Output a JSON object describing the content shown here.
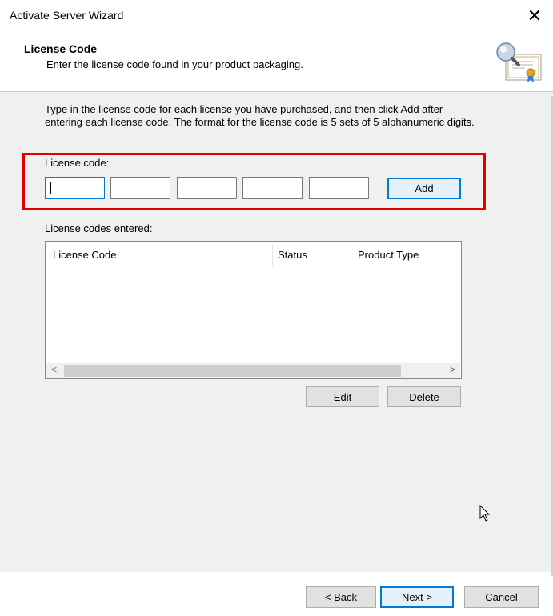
{
  "window": {
    "title": "Activate Server Wizard",
    "close_glyph": "✕"
  },
  "header": {
    "title": "License Code",
    "subtitle": "Enter the license code found in your product packaging.",
    "icon": "certificate-icon"
  },
  "body": {
    "instructions": "Type in the license code for each license you have purchased, and then click Add after entering each license code. The format for the license code is 5 sets of 5 alphanumeric digits.",
    "license_code_label": "License code:",
    "code_fields": [
      "",
      "",
      "",
      "",
      ""
    ],
    "add_label": "Add",
    "entered_label": "License codes entered:",
    "columns": [
      "License Code",
      "Status",
      "Product Type"
    ],
    "rows": [],
    "scroll_left": "<",
    "scroll_right": ">",
    "edit_label": "Edit",
    "delete_label": "Delete"
  },
  "footer": {
    "back_label": "< Back",
    "next_label": "Next >",
    "cancel_label": "Cancel"
  },
  "colors": {
    "highlight": "#e00000",
    "accent": "#0078d7"
  }
}
